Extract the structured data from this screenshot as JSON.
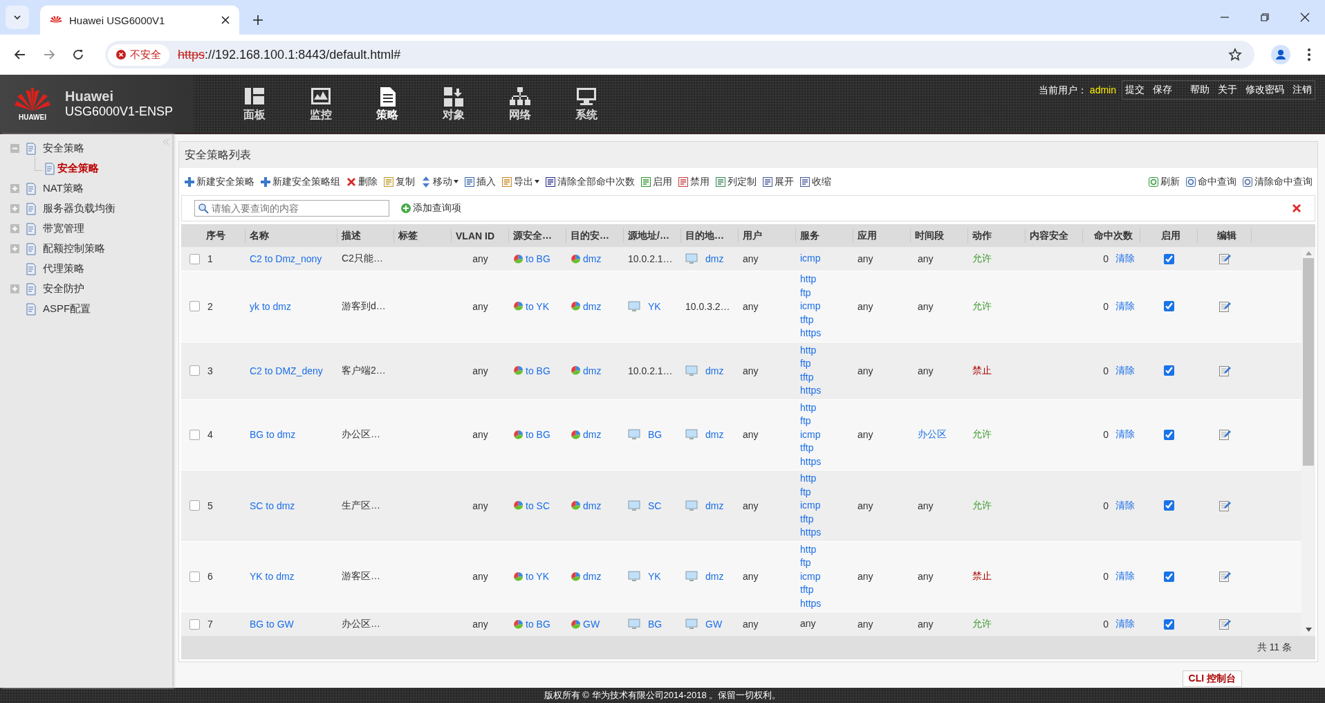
{
  "browser": {
    "tab_title": "Huawei USG6000V1",
    "security_label": "不安全",
    "url_scheme": "https",
    "url_rest": "://192.168.100.1:8443/default.html#"
  },
  "header": {
    "logo_text": "HUAWEI",
    "brand": "Huawei",
    "product": "USG6000V1-ENSP",
    "nav": [
      {
        "label": "面板",
        "kind": "dashboard",
        "selected": false
      },
      {
        "label": "监控",
        "kind": "monitor",
        "selected": false
      },
      {
        "label": "策略",
        "kind": "policy",
        "selected": true
      },
      {
        "label": "对象",
        "kind": "object",
        "selected": false
      },
      {
        "label": "网络",
        "kind": "network",
        "selected": false
      },
      {
        "label": "系统",
        "kind": "system",
        "selected": false
      }
    ],
    "user_label": "当前用户：",
    "user": "admin",
    "links": [
      "提交",
      "保存",
      "帮助",
      "关于",
      "修改密码",
      "注销"
    ]
  },
  "sidebar": {
    "items": [
      {
        "label": "安全策略",
        "kind": "folder",
        "expanded": true,
        "selected": false,
        "children": [
          {
            "label": "安全策略",
            "selected": true
          }
        ]
      },
      {
        "label": "NAT策略",
        "kind": "folder",
        "expanded": false,
        "selected": false
      },
      {
        "label": "服务器负载均衡",
        "kind": "folder",
        "expanded": false,
        "selected": false
      },
      {
        "label": "带宽管理",
        "kind": "folder",
        "expanded": false,
        "selected": false
      },
      {
        "label": "配额控制策略",
        "kind": "folder",
        "expanded": false,
        "selected": false
      },
      {
        "label": "代理策略",
        "kind": "leaf",
        "selected": false
      },
      {
        "label": "安全防护",
        "kind": "folder",
        "expanded": false,
        "selected": false
      },
      {
        "label": "ASPF配置",
        "kind": "leaf",
        "selected": false
      }
    ]
  },
  "panel": {
    "title": "安全策略列表",
    "toolbar": [
      {
        "label": "新建安全策略",
        "kind": "add",
        "dropdown": false
      },
      {
        "label": "新建安全策略组",
        "kind": "add",
        "dropdown": false
      },
      {
        "label": "删除",
        "kind": "delete",
        "dropdown": false
      },
      {
        "label": "复制",
        "kind": "copy",
        "dropdown": false
      },
      {
        "label": "移动",
        "kind": "move",
        "dropdown": true
      },
      {
        "label": "插入",
        "kind": "insert",
        "dropdown": false
      },
      {
        "label": "导出",
        "kind": "export",
        "dropdown": true
      },
      {
        "label": "清除全部命中次数",
        "kind": "counter",
        "dropdown": false
      },
      {
        "label": "启用",
        "kind": "enable",
        "dropdown": false
      },
      {
        "label": "禁用",
        "kind": "disable",
        "dropdown": false
      },
      {
        "label": "列定制",
        "kind": "columns",
        "dropdown": false
      },
      {
        "label": "展开",
        "kind": "expand",
        "dropdown": false
      },
      {
        "label": "收缩",
        "kind": "collapse",
        "dropdown": false
      }
    ],
    "toolbar_right": [
      {
        "label": "刷新",
        "kind": "refresh"
      },
      {
        "label": "命中查询",
        "kind": "query"
      },
      {
        "label": "清除命中查询",
        "kind": "clear-query"
      }
    ],
    "search": {
      "placeholder": "请输入要查询的内容"
    },
    "add_query": "添加查询项",
    "table": {
      "columns": [
        "序号",
        "名称",
        "描述",
        "标签",
        "VLAN ID",
        "源安全…",
        "目的安…",
        "源地址/…",
        "目的地…",
        "用户",
        "服务",
        "应用",
        "时间段",
        "动作",
        "内容安全",
        "命中次数",
        "启用",
        "编辑"
      ],
      "rows": [
        {
          "selected": false,
          "no": "1",
          "name": "C2 to Dmz_nony",
          "description": "C2只能…",
          "vlan": "any",
          "src_zone": "to BG",
          "dst_zone": "dmz",
          "src_addr": {
            "text": "10.0.2.1…",
            "kind": "address"
          },
          "dst_addr": {
            "text": "dmz",
            "kind": "group"
          },
          "user": "any",
          "services": [
            {
              "text": "icmp",
              "kind": "link"
            }
          ],
          "application": "any",
          "schedule": {
            "text": "any",
            "kind": "plain"
          },
          "action": {
            "text": "允许",
            "kind": "allow"
          },
          "hits": "0",
          "clear": "清除",
          "enabled": true
        },
        {
          "selected": false,
          "no": "2",
          "name": "yk to dmz",
          "description": "游客到d…",
          "vlan": "any",
          "src_zone": "to YK",
          "dst_zone": "dmz",
          "src_addr": {
            "text": "YK",
            "kind": "group"
          },
          "dst_addr": {
            "text": "10.0.3.2…",
            "kind": "address"
          },
          "user": "any",
          "services": [
            {
              "text": "http",
              "kind": "link"
            },
            {
              "text": "ftp",
              "kind": "link"
            },
            {
              "text": "icmp",
              "kind": "link"
            },
            {
              "text": "tftp",
              "kind": "link"
            },
            {
              "text": "https",
              "kind": "link"
            }
          ],
          "application": "any",
          "schedule": {
            "text": "any",
            "kind": "plain"
          },
          "action": {
            "text": "允许",
            "kind": "allow"
          },
          "hits": "0",
          "clear": "清除",
          "enabled": true
        },
        {
          "selected": false,
          "no": "3",
          "name": "C2 to DMZ_deny",
          "description": "客户端2…",
          "vlan": "any",
          "src_zone": "to BG",
          "dst_zone": "dmz",
          "src_addr": {
            "text": "10.0.2.1…",
            "kind": "address"
          },
          "dst_addr": {
            "text": "dmz",
            "kind": "group"
          },
          "user": "any",
          "services": [
            {
              "text": "http",
              "kind": "link"
            },
            {
              "text": "ftp",
              "kind": "link"
            },
            {
              "text": "tftp",
              "kind": "link"
            },
            {
              "text": "https",
              "kind": "link"
            }
          ],
          "application": "any",
          "schedule": {
            "text": "any",
            "kind": "plain"
          },
          "action": {
            "text": "禁止",
            "kind": "deny"
          },
          "hits": "0",
          "clear": "清除",
          "enabled": true
        },
        {
          "selected": false,
          "no": "4",
          "name": "BG to dmz",
          "description": "办公区…",
          "vlan": "any",
          "src_zone": "to BG",
          "dst_zone": "dmz",
          "src_addr": {
            "text": "BG",
            "kind": "group"
          },
          "dst_addr": {
            "text": "dmz",
            "kind": "group"
          },
          "user": "any",
          "services": [
            {
              "text": "http",
              "kind": "link"
            },
            {
              "text": "ftp",
              "kind": "link"
            },
            {
              "text": "icmp",
              "kind": "link"
            },
            {
              "text": "tftp",
              "kind": "link"
            },
            {
              "text": "https",
              "kind": "link"
            }
          ],
          "application": "any",
          "schedule": {
            "text": "办公区",
            "kind": "link"
          },
          "action": {
            "text": "允许",
            "kind": "allow"
          },
          "hits": "0",
          "clear": "清除",
          "enabled": true
        },
        {
          "selected": false,
          "no": "5",
          "name": "SC to dmz",
          "description": "生产区…",
          "vlan": "any",
          "src_zone": "to SC",
          "dst_zone": "dmz",
          "src_addr": {
            "text": "SC",
            "kind": "group"
          },
          "dst_addr": {
            "text": "dmz",
            "kind": "group"
          },
          "user": "any",
          "services": [
            {
              "text": "http",
              "kind": "link"
            },
            {
              "text": "ftp",
              "kind": "link"
            },
            {
              "text": "icmp",
              "kind": "link"
            },
            {
              "text": "tftp",
              "kind": "link"
            },
            {
              "text": "https",
              "kind": "link"
            }
          ],
          "application": "any",
          "schedule": {
            "text": "any",
            "kind": "plain"
          },
          "action": {
            "text": "允许",
            "kind": "allow"
          },
          "hits": "0",
          "clear": "清除",
          "enabled": true
        },
        {
          "selected": false,
          "no": "6",
          "name": "YK to dmz",
          "description": "游客区…",
          "vlan": "any",
          "src_zone": "to YK",
          "dst_zone": "dmz",
          "src_addr": {
            "text": "YK",
            "kind": "group"
          },
          "dst_addr": {
            "text": "dmz",
            "kind": "group"
          },
          "user": "any",
          "services": [
            {
              "text": "http",
              "kind": "link"
            },
            {
              "text": "ftp",
              "kind": "link"
            },
            {
              "text": "icmp",
              "kind": "link"
            },
            {
              "text": "tftp",
              "kind": "link"
            },
            {
              "text": "https",
              "kind": "link"
            }
          ],
          "application": "any",
          "schedule": {
            "text": "any",
            "kind": "plain"
          },
          "action": {
            "text": "禁止",
            "kind": "deny"
          },
          "hits": "0",
          "clear": "清除",
          "enabled": true
        },
        {
          "selected": false,
          "no": "7",
          "name": "BG to GW",
          "description": "办公区…",
          "vlan": "any",
          "src_zone": "to BG",
          "dst_zone": "GW",
          "src_addr": {
            "text": "BG",
            "kind": "group"
          },
          "dst_addr": {
            "text": "GW",
            "kind": "group"
          },
          "user": "any",
          "services": [
            {
              "text": "any",
              "kind": "plain"
            }
          ],
          "application": "any",
          "schedule": {
            "text": "any",
            "kind": "plain"
          },
          "action": {
            "text": "允许",
            "kind": "allow"
          },
          "hits": "0",
          "clear": "清除",
          "enabled": true
        }
      ]
    },
    "total": "共 11 条"
  },
  "cli_button": "CLI 控制台",
  "footer": "版权所有 © 华为技术有限公司2014-2018 。保留一切权利。"
}
